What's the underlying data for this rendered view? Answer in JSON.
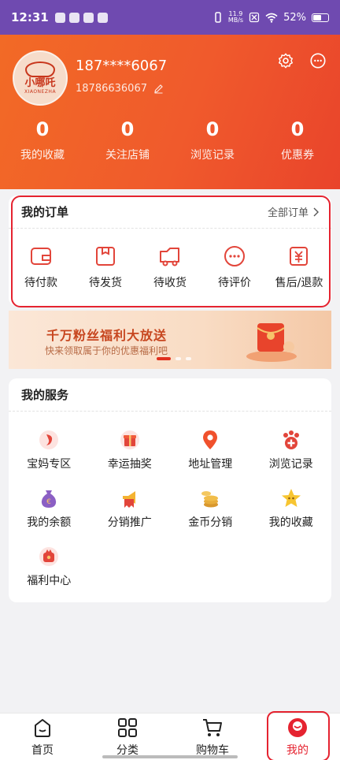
{
  "status_bar": {
    "time": "12:31",
    "net_speed_value": "11.9",
    "net_speed_unit": "MB/s",
    "battery": "52%"
  },
  "user": {
    "avatar_brand": "小哪吒",
    "avatar_brand_en": "XIAONEZHA",
    "display_name": "187****6067",
    "phone": "18786636067"
  },
  "stats": [
    {
      "value": "0",
      "label": "我的收藏"
    },
    {
      "value": "0",
      "label": "关注店铺"
    },
    {
      "value": "0",
      "label": "浏览记录"
    },
    {
      "value": "0",
      "label": "优惠券"
    }
  ],
  "orders": {
    "title": "我的订单",
    "all_link": "全部订单",
    "items": [
      {
        "label": "待付款",
        "icon": "wallet-icon"
      },
      {
        "label": "待发货",
        "icon": "package-icon"
      },
      {
        "label": "待收货",
        "icon": "truck-icon"
      },
      {
        "label": "待评价",
        "icon": "comment-icon"
      },
      {
        "label": "售后/退款",
        "icon": "refund-icon"
      }
    ]
  },
  "banner": {
    "title": "千万粉丝福利大放送",
    "subtitle": "快来领取属于你的优惠福利吧"
  },
  "services": {
    "title": "我的服务",
    "items": [
      {
        "label": "宝妈专区",
        "icon": "mom-zone-icon"
      },
      {
        "label": "幸运抽奖",
        "icon": "gift-icon"
      },
      {
        "label": "地址管理",
        "icon": "location-pin-icon"
      },
      {
        "label": "浏览记录",
        "icon": "paw-history-icon"
      },
      {
        "label": "我的余额",
        "icon": "money-bag-icon"
      },
      {
        "label": "分销推广",
        "icon": "trumpet-icon"
      },
      {
        "label": "金币分销",
        "icon": "coins-icon"
      },
      {
        "label": "我的收藏",
        "icon": "star-icon"
      },
      {
        "label": "福利中心",
        "icon": "welfare-icon"
      }
    ]
  },
  "nav": [
    {
      "label": "首页",
      "icon": "home-icon"
    },
    {
      "label": "分类",
      "icon": "category-icon"
    },
    {
      "label": "购物车",
      "icon": "cart-icon"
    },
    {
      "label": "我的",
      "icon": "profile-icon"
    }
  ],
  "colors": {
    "accent": "#e52330",
    "header_start": "#f26a26",
    "header_end": "#e9442b"
  }
}
